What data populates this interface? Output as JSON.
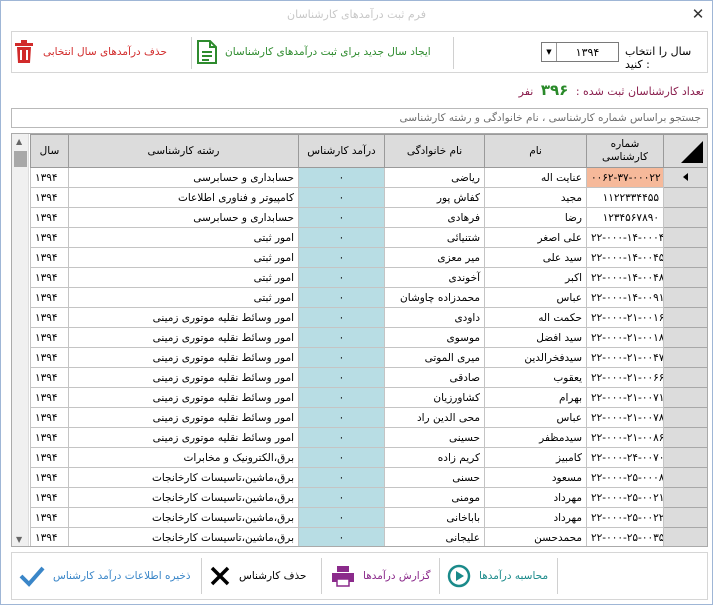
{
  "window": {
    "title": "فرم ثبت درآمدهای کارشناسان"
  },
  "toolbar": {
    "delete_year_label": "حذف درآمدهای سال انتخابی",
    "new_year_label": "ایجاد سال جدید برای ثبت درآمدهای کارشناسان",
    "year_select_label": "سال را انتخاب کنید :",
    "year_value": "۱۳۹۴"
  },
  "count": {
    "label": "تعداد کارشناسان ثبت شده :",
    "value": "۳۹۶",
    "unit": "نفر"
  },
  "search": {
    "placeholder": "جستجو براساس شماره کارشناسی ، نام خانوادگی و رشته کارشناسی"
  },
  "table": {
    "columns": {
      "year": "سال",
      "field": "رشته کارشناسی",
      "income": "درآمد کارشناس",
      "family": "نام خانوادگی",
      "name": "نام",
      "code": "شماره کارشناسی"
    },
    "rows": [
      {
        "year": "۱۳۹۴",
        "field": "حسابداری و حسابرسی",
        "income": "۰",
        "family": "ریاضی",
        "name": "عنایت اله",
        "code": "۰۰۶۲-۳۷-۰۰۰۲۲"
      },
      {
        "year": "۱۳۹۴",
        "field": "کامپیوتر و فناوری اطلاعات",
        "income": "۰",
        "family": "کفاش پور",
        "name": "مجید",
        "code": "۱۱۲۲۳۳۴۴۵۵"
      },
      {
        "year": "۱۳۹۴",
        "field": "حسابداری و حسابرسی",
        "income": "۰",
        "family": "فرهادی",
        "name": "رضا",
        "code": "۱۲۳۴۵۶۷۸۹۰"
      },
      {
        "year": "۱۳۹۴",
        "field": "امور ثبتی",
        "income": "۰",
        "family": "شتنیائی",
        "name": "علی اصغر",
        "code": "۲۲-۰۰۰-۱۴-۰۰۰۴"
      },
      {
        "year": "۱۳۹۴",
        "field": "امور ثبتی",
        "income": "۰",
        "family": "میر معزی",
        "name": "سید علی",
        "code": "۲۲-۰۰۰-۱۴-۰۰۴۵"
      },
      {
        "year": "۱۳۹۴",
        "field": "امور ثبتی",
        "income": "۰",
        "family": "آخوندی",
        "name": "اکبر",
        "code": "۲۲-۰۰۰-۱۴-۰۰۴۸"
      },
      {
        "year": "۱۳۹۴",
        "field": "امور ثبتی",
        "income": "۰",
        "family": "محمدزاده چاوشان",
        "name": "عباس",
        "code": "۲۲-۰۰۰-۱۴-۰۰۹۱"
      },
      {
        "year": "۱۳۹۴",
        "field": "امور وسائط نقلیه موتوری زمینی",
        "income": "۰",
        "family": "داودی",
        "name": "حکمت اله",
        "code": "۲۲-۰۰۰-۲۱-۰۰۱۶"
      },
      {
        "year": "۱۳۹۴",
        "field": "امور وسائط نقلیه موتوری زمینی",
        "income": "۰",
        "family": "موسوی",
        "name": "سید افضل",
        "code": "۲۲-۰۰۰-۲۱-۰۰۱۸"
      },
      {
        "year": "۱۳۹۴",
        "field": "امور وسائط نقلیه موتوری زمینی",
        "income": "۰",
        "family": "میری الموتی",
        "name": "سیدفخرالدین",
        "code": "۲۲-۰۰۰-۲۱-۰۰۴۷"
      },
      {
        "year": "۱۳۹۴",
        "field": "امور وسائط نقلیه موتوری زمینی",
        "income": "۰",
        "family": "صادقی",
        "name": "یعقوب",
        "code": "۲۲-۰۰۰-۲۱-۰۰۶۶"
      },
      {
        "year": "۱۳۹۴",
        "field": "امور وسائط نقلیه موتوری زمینی",
        "income": "۰",
        "family": "کشاورزیان",
        "name": "بهرام",
        "code": "۲۲-۰۰۰-۲۱-۰۰۷۱"
      },
      {
        "year": "۱۳۹۴",
        "field": "امور وسائط نقلیه موتوری زمینی",
        "income": "۰",
        "family": "محی الدین راد",
        "name": "عباس",
        "code": "۲۲-۰۰۰-۲۱-۰۰۷۸"
      },
      {
        "year": "۱۳۹۴",
        "field": "امور وسائط نقلیه موتوری زمینی",
        "income": "۰",
        "family": "حسینی",
        "name": "سیدمظفر",
        "code": "۲۲-۰۰۰-۲۱-۰۰۸۶"
      },
      {
        "year": "۱۳۹۴",
        "field": "برق،الکترونیک و مخابرات",
        "income": "۰",
        "family": "کریم زاده",
        "name": "کامبیز",
        "code": "۲۲-۰۰۰-۲۴-۰۰۷۰"
      },
      {
        "year": "۱۳۹۴",
        "field": "برق،ماشین،تاسیسات کارخانجات",
        "income": "۰",
        "family": "حسنی",
        "name": "مسعود",
        "code": "۲۲-۰۰۰-۲۵-۰۰۰۸"
      },
      {
        "year": "۱۳۹۴",
        "field": "برق،ماشین،تاسیسات کارخانجات",
        "income": "۰",
        "family": "مومنی",
        "name": "مهرداد",
        "code": "۲۲-۰۰۰-۲۵-۰۰۲۱"
      },
      {
        "year": "۱۳۹۴",
        "field": "برق،ماشین،تاسیسات کارخانجات",
        "income": "۰",
        "family": "باباخانی",
        "name": "مهرداد",
        "code": "۲۲-۰۰۰-۲۵-۰۰۲۲"
      },
      {
        "year": "۱۳۹۴",
        "field": "برق،ماشین،تاسیسات کارخانجات",
        "income": "۰",
        "family": "علیجانی",
        "name": "محمدحسن",
        "code": "۲۲-۰۰۰-۲۵-۰۰۳۵"
      }
    ]
  },
  "bottom": {
    "save_label": "ذخیره اطلاعات درآمد کارشناس",
    "delete_label": "حذف کارشناس",
    "report_label": "گزارش درآمدها",
    "calc_label": "محاسبه درآمدها"
  },
  "colors": {
    "income_cell": "#b8dde4",
    "selected_code": "#f6b99a",
    "count_number": "#2a8a2a",
    "delete_red": "#d12a2a",
    "save_blue": "#3a86c8"
  },
  "icons": [
    "trash-icon",
    "document-icon",
    "check-icon",
    "x-icon",
    "printer-icon",
    "play-circle-icon",
    "close-icon"
  ]
}
